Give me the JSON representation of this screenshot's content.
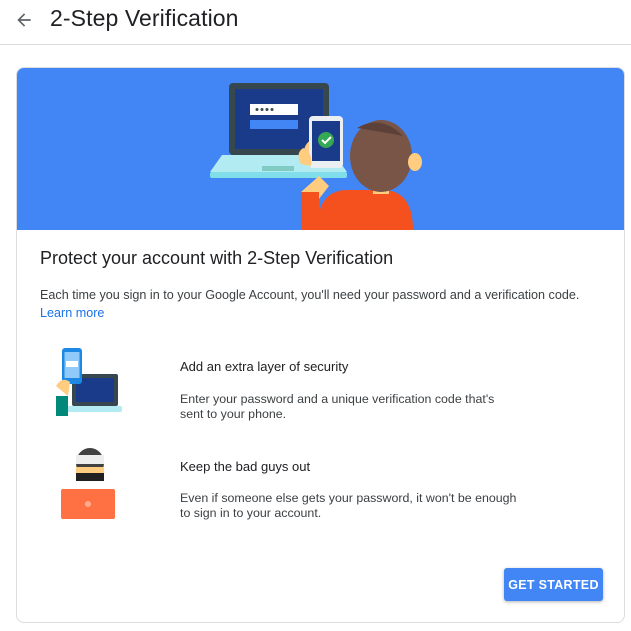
{
  "header": {
    "title": "2-Step Verification",
    "back_icon": "arrow-back-icon"
  },
  "card": {
    "heading": "Protect your account with 2-Step Verification",
    "description": "Each time you sign in to your Google Account, you'll need your password and a verification code.",
    "learn_more": "Learn more",
    "features": [
      {
        "icon": "phone-laptop-security-icon",
        "title": "Add an extra layer of security",
        "text": "Enter your password and a unique verification code that's sent to your phone."
      },
      {
        "icon": "masked-intruder-icon",
        "title": "Keep the bad guys out",
        "text": "Even if someone else gets your password, it won't be enough to sign in to your account."
      }
    ],
    "button_label": "GET STARTED"
  },
  "colors": {
    "banner": "#4285f4",
    "button": "#4285f4",
    "link": "#1a73e8"
  }
}
